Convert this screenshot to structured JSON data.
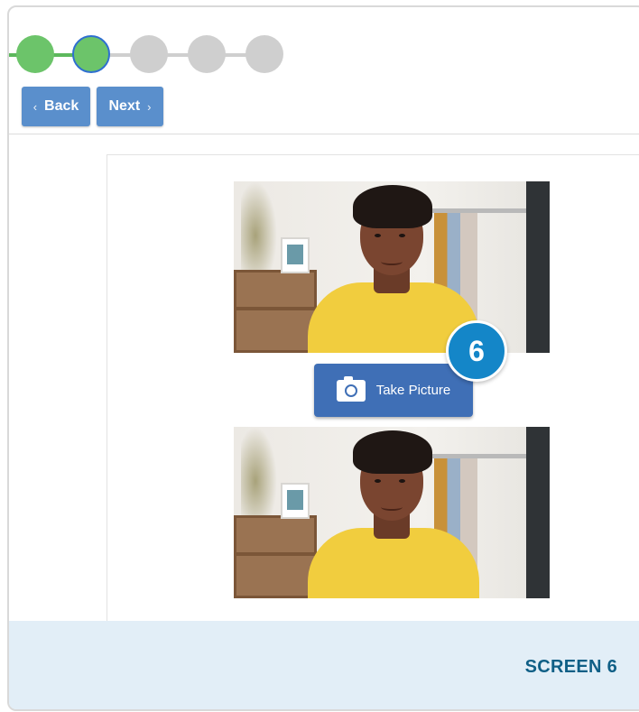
{
  "navigation": {
    "back_label": "Back",
    "next_label": "Next",
    "back_icon": "chevron-left-icon",
    "next_icon": "chevron-right-icon"
  },
  "stepper": {
    "total_steps": 5,
    "completed_steps": 1,
    "current_step": 2
  },
  "camera": {
    "take_picture_label": "Take Picture",
    "icon": "camera-icon"
  },
  "callout": {
    "number": "6"
  },
  "footer": {
    "label": "SCREEN 6"
  },
  "colors": {
    "step_done": "#6cc46a",
    "step_pending": "#cfcfcf",
    "current_outline": "#2f6fd0",
    "nav_button": "#5a8fcc",
    "take_picture_button": "#3f6fb6",
    "badge": "#1486c8",
    "footer_bg": "#e2eef7",
    "footer_text": "#0f5f86"
  }
}
